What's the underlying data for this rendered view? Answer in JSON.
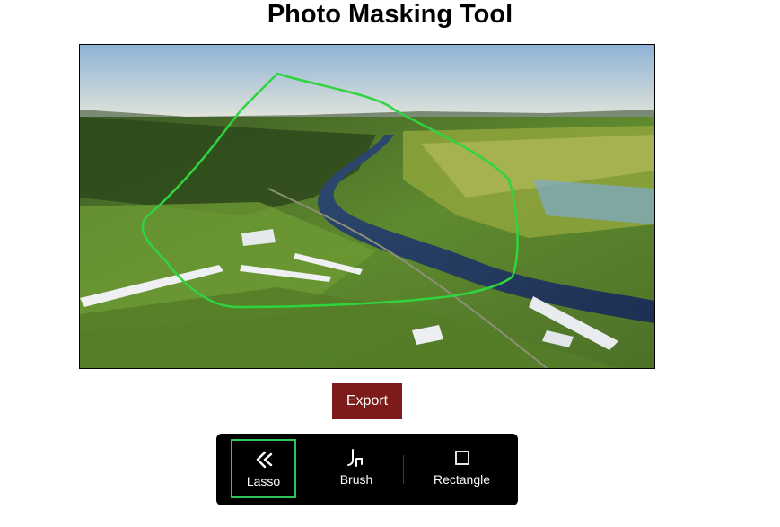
{
  "page": {
    "title": "Photo Masking Tool"
  },
  "canvas": {
    "mask_color": "#2fd43f"
  },
  "actions": {
    "export_label": "Export",
    "export_color": "#7d1a1a"
  },
  "toolbar": {
    "active_tool": "lasso",
    "active_border_color": "#2fc35a",
    "tools": [
      {
        "id": "lasso",
        "label": "Lasso",
        "icon": "lasso-icon"
      },
      {
        "id": "brush",
        "label": "Brush",
        "icon": "brush-icon"
      },
      {
        "id": "rectangle",
        "label": "Rectangle",
        "icon": "rectangle-icon"
      }
    ]
  }
}
